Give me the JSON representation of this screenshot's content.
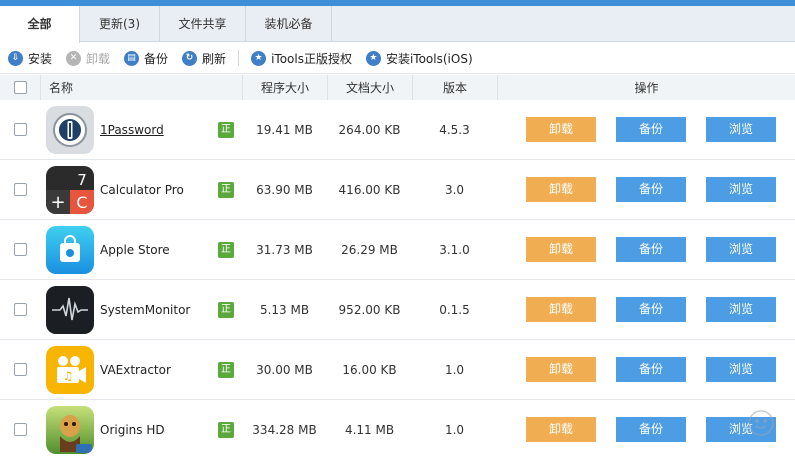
{
  "tabs": [
    {
      "label": "全部",
      "active": true
    },
    {
      "label": "更新(3)",
      "active": false
    },
    {
      "label": "文件共享",
      "active": false
    },
    {
      "label": "装机必备",
      "active": false
    }
  ],
  "toolbar": {
    "install": "安装",
    "uninstall": "卸载",
    "backup": "备份",
    "refresh": "刷新",
    "itools_auth": "iTools正版授权",
    "install_itools": "安装iTools(iOS)"
  },
  "table": {
    "headers": {
      "name": "名称",
      "app_size": "程序大小",
      "doc_size": "文档大小",
      "version": "版本",
      "actions": "操作"
    },
    "badge": "正",
    "buttons": {
      "uninstall": "卸载",
      "backup": "备份",
      "browse": "浏览"
    },
    "rows": [
      {
        "name": "1Password",
        "app_size": "19.41 MB",
        "doc_size": "264.00 KB",
        "version": "4.5.3",
        "icon": "1password-icon"
      },
      {
        "name": "Calculator Pro",
        "app_size": "63.90 MB",
        "doc_size": "416.00 KB",
        "version": "3.0",
        "icon": "calculator-icon"
      },
      {
        "name": "Apple Store",
        "app_size": "31.73 MB",
        "doc_size": "26.29 MB",
        "version": "3.1.0",
        "icon": "apple-store-icon"
      },
      {
        "name": "SystemMonitor",
        "app_size": "5.13 MB",
        "doc_size": "952.00 KB",
        "version": "0.1.5",
        "icon": "system-monitor-icon"
      },
      {
        "name": "VAExtractor",
        "app_size": "30.00 MB",
        "doc_size": "16.00 KB",
        "version": "1.0",
        "icon": "vaextractor-icon"
      },
      {
        "name": "Origins HD",
        "app_size": "334.28 MB",
        "doc_size": "4.11 MB",
        "version": "1.0",
        "icon": "origins-hd-icon"
      }
    ]
  },
  "colors": {
    "accent": "#3d8fd9",
    "uninstall_button": "#f0ad52",
    "backup_button": "#4d9de5",
    "badge": "#5ba83b"
  }
}
